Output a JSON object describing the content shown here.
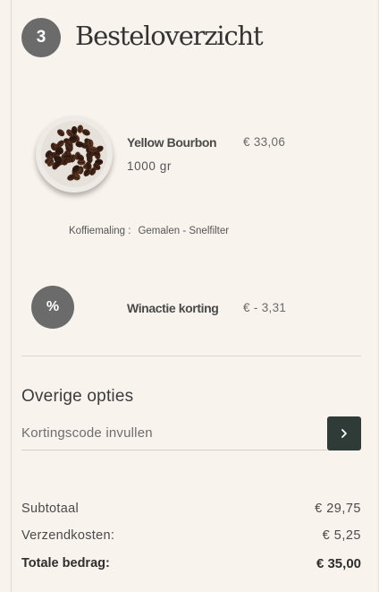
{
  "header": {
    "step_number": "3",
    "title": "Besteloverzicht"
  },
  "product": {
    "name": "Yellow Bourbon",
    "price": "€ 33,06",
    "weight": "1000 gr",
    "grind_label": "Koffiemaling :",
    "grind_value": "Gemalen - Snelfilter",
    "image_icon": "coffee-beans-image"
  },
  "discount": {
    "badge_symbol": "%",
    "name": "Winactie korting",
    "amount": "€ - 3,31"
  },
  "options": {
    "heading": "Overige opties",
    "coupon_placeholder": "Kortingscode invullen",
    "coupon_value": "",
    "submit_icon": "chevron-right-icon"
  },
  "totals": {
    "subtotal_label": "Subtotaal",
    "subtotal_value": "€ 29,75",
    "shipping_label": "Verzendkosten:",
    "shipping_value": "€ 5,25",
    "total_label": "Totale bedrag:",
    "total_value": "€ 35,00"
  },
  "colors": {
    "background": "#f8f3ed",
    "badge": "#6b6b6b",
    "button": "#2e3b36",
    "text": "#3a3a3a"
  }
}
